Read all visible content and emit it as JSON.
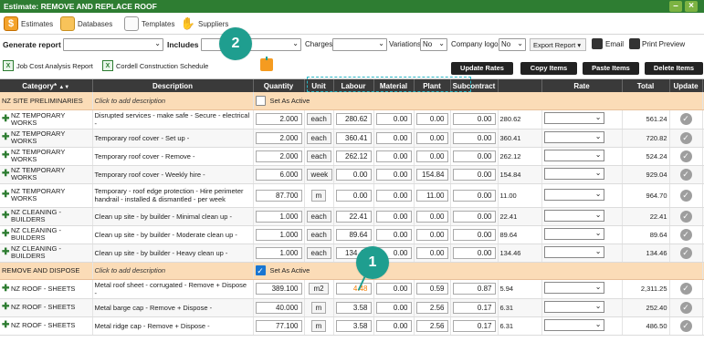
{
  "window": {
    "title": "Estimate: REMOVE AND REPLACE ROOF",
    "min": "–",
    "close": "×"
  },
  "tabs": [
    {
      "label": "Estimates",
      "icon": "dollar-icon"
    },
    {
      "label": "Databases",
      "icon": "folder-icon"
    },
    {
      "label": "Templates",
      "icon": "document-icon"
    },
    {
      "label": "Suppliers",
      "icon": "handshake-icon"
    }
  ],
  "toolbar": {
    "generate_report": "Generate report",
    "includes": "Includes",
    "charges": "Charges",
    "variations": "Variations",
    "variations_value": "No",
    "company_logo": "Company logo",
    "company_logo_value": "No",
    "export_report": "Export Report",
    "email": "Email",
    "print_preview": "Print Preview"
  },
  "reports": {
    "job_cost": "Job Cost Analysis Report",
    "cordell": "Cordell Construction Schedule"
  },
  "actions": {
    "update_rates": "Update Rates",
    "copy_items": "Copy Items",
    "paste_items": "Paste Items",
    "delete_items": "Delete Items"
  },
  "callouts": {
    "one": "1",
    "two": "2"
  },
  "columns": {
    "category": "Category*",
    "sort": "▲▼",
    "description": "Description",
    "quantity": "Quantity",
    "unit": "Unit",
    "labour": "Labour",
    "material": "Material",
    "plant": "Plant",
    "subcontract": "Subcontract",
    "rate": "Rate",
    "total": "Total",
    "update": "Update"
  },
  "sections": [
    {
      "name": "NZ SITE PRELIMINARIES",
      "desc": "Click to add description",
      "active_label": "Set As Active",
      "active": false,
      "rows": [
        {
          "cat": "NZ TEMPORARY WORKS",
          "desc": "Disrupted services - make safe - Secure - electrical -",
          "qty": "2.000",
          "unit": "each",
          "labour": "280.62",
          "material": "0.00",
          "plant": "0.00",
          "sub": "0.00",
          "rate": "280.62",
          "total": "561.24"
        },
        {
          "cat": "NZ TEMPORARY WORKS",
          "desc": "Temporary roof cover - Set up -",
          "qty": "2.000",
          "unit": "each",
          "labour": "360.41",
          "material": "0.00",
          "plant": "0.00",
          "sub": "0.00",
          "rate": "360.41",
          "total": "720.82"
        },
        {
          "cat": "NZ TEMPORARY WORKS",
          "desc": "Temporary roof cover - Remove -",
          "qty": "2.000",
          "unit": "each",
          "labour": "262.12",
          "material": "0.00",
          "plant": "0.00",
          "sub": "0.00",
          "rate": "262.12",
          "total": "524.24"
        },
        {
          "cat": "NZ TEMPORARY WORKS",
          "desc": "Temporary roof cover - Weekly hire -",
          "qty": "6.000",
          "unit": "week",
          "labour": "0.00",
          "material": "0.00",
          "plant": "154.84",
          "sub": "0.00",
          "rate": "154.84",
          "total": "929.04"
        },
        {
          "cat": "NZ TEMPORARY WORKS",
          "desc": "Temporary - roof edge protection - Hire perimeter handrail - installed & dismantled - per week",
          "qty": "87.700",
          "unit": "m",
          "labour": "0.00",
          "material": "0.00",
          "plant": "11.00",
          "sub": "0.00",
          "rate": "11.00",
          "total": "964.70"
        },
        {
          "cat": "NZ CLEANING - BUILDERS",
          "desc": "Clean up site - by builder - Minimal clean up -",
          "qty": "1.000",
          "unit": "each",
          "labour": "22.41",
          "material": "0.00",
          "plant": "0.00",
          "sub": "0.00",
          "rate": "22.41",
          "total": "22.41"
        },
        {
          "cat": "NZ CLEANING - BUILDERS",
          "desc": "Clean up site - by builder - Moderate clean up -",
          "qty": "1.000",
          "unit": "each",
          "labour": "89.64",
          "material": "0.00",
          "plant": "0.00",
          "sub": "0.00",
          "rate": "89.64",
          "total": "89.64"
        },
        {
          "cat": "NZ CLEANING - BUILDERS",
          "desc": "Clean up site - by builder - Heavy clean up -",
          "qty": "1.000",
          "unit": "each",
          "labour": "134.46",
          "material": "0.00",
          "plant": "0.00",
          "sub": "0.00",
          "rate": "134.46",
          "total": "134.46"
        }
      ]
    },
    {
      "name": "REMOVE AND DISPOSE",
      "desc": "Click to add description",
      "active_label": "Set As Active",
      "active": true,
      "rows": [
        {
          "cat": "NZ ROOF - SHEETS",
          "desc": "Metal roof sheet - corrugated - Remove + Dispose -",
          "qty": "389.100",
          "unit": "m2",
          "labour": "4.48",
          "material": "0.00",
          "plant": "0.59",
          "sub": "0.87",
          "rate": "5.94",
          "total": "2,311.25",
          "labour_highlight": true
        },
        {
          "cat": "NZ ROOF - SHEETS",
          "desc": "Metal barge cap - Remove + Dispose -",
          "qty": "40.000",
          "unit": "m",
          "labour": "3.58",
          "material": "0.00",
          "plant": "2.56",
          "sub": "0.17",
          "rate": "6.31",
          "total": "252.40"
        },
        {
          "cat": "NZ ROOF - SHEETS",
          "desc": "Metal ridge cap - Remove + Dispose -",
          "qty": "77.100",
          "unit": "m",
          "labour": "3.58",
          "material": "0.00",
          "plant": "2.56",
          "sub": "0.17",
          "rate": "6.31",
          "total": "486.50"
        }
      ]
    }
  ]
}
